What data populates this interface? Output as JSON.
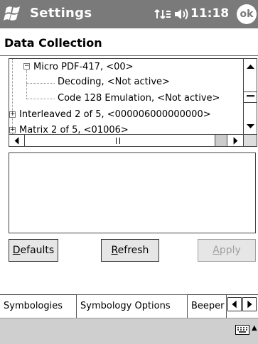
{
  "titlebar": {
    "app_title": "Settings",
    "time": "11:18",
    "ok_label": "ok"
  },
  "page": {
    "title": "Data Collection"
  },
  "tree": {
    "items": [
      {
        "label": "Micro PDF-417, <00>",
        "expanded": true
      },
      {
        "label": "Decoding, <Not active>"
      },
      {
        "label": "Code 128 Emulation, <Not active>"
      },
      {
        "label": "Interleaved 2 of 5, <000006000000000>",
        "expanded": false
      },
      {
        "label": "Matrix 2 of 5, <01006>",
        "expanded": false
      }
    ]
  },
  "buttons": {
    "defaults": {
      "first": "D",
      "rest": "efaults"
    },
    "refresh": {
      "first": "R",
      "rest": "efresh"
    },
    "apply": {
      "first": "A",
      "rest": "pply",
      "enabled": false
    }
  },
  "tabs": [
    {
      "label": "Symbologies",
      "selected": true
    },
    {
      "label": "Symbology Options",
      "selected": false
    },
    {
      "label": "Beeper",
      "selected": false
    }
  ],
  "icons": {
    "start": "windows-flag-icon",
    "connectivity": "connectivity-icon",
    "volume": "speaker-icon",
    "keyboard": "keyboard-icon"
  },
  "colors": {
    "titlebar": "#7a7a7a",
    "menubar": "#cfcfcf"
  }
}
